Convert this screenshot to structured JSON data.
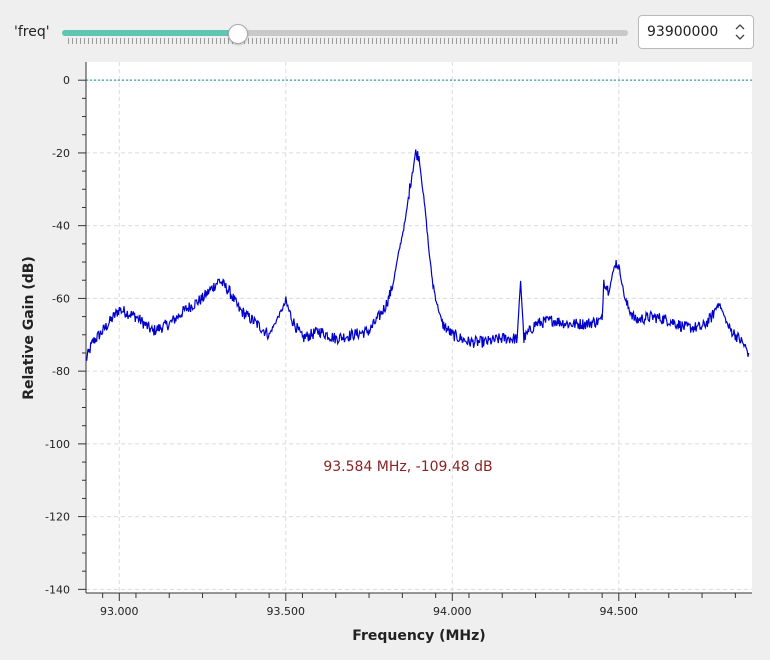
{
  "control": {
    "label": "'freq'",
    "spinbox_value": "93900000",
    "slider_fraction": 0.31
  },
  "plot": {
    "marker_readout": "93.584 MHz, -109.48 dB"
  },
  "colors": {
    "trace": "#0000cc",
    "reference_line": "#0f8a8a",
    "marker_text": "#8b2323",
    "slider_accent": "#5fc7b1"
  },
  "chart_data": {
    "type": "line",
    "xlabel": "Frequency (MHz)",
    "ylabel": "Relative Gain (dB)",
    "xlim": [
      92.9,
      94.9
    ],
    "ylim": [
      -140,
      0
    ],
    "x_ticks": [
      93.0,
      93.5,
      94.0,
      94.5
    ],
    "x_tick_labels": [
      "93.000",
      "93.500",
      "94.000",
      "94.500"
    ],
    "y_ticks": [
      0,
      -20,
      -40,
      -60,
      -80,
      -100,
      -120,
      -140
    ],
    "y_tick_labels": [
      "0",
      "-20",
      "-40",
      "-60",
      "-80",
      "-100",
      "-120",
      "-140"
    ],
    "reference_line_y": 0,
    "grid": true,
    "series": [
      {
        "x": [
          92.9,
          92.92,
          92.95,
          93.0,
          93.05,
          93.1,
          93.15,
          93.2,
          93.25,
          93.28,
          93.3,
          93.33,
          93.36,
          93.4,
          93.45,
          93.5,
          93.52,
          93.55,
          93.6,
          93.65,
          93.7,
          93.75,
          93.78,
          93.8,
          93.82,
          93.84,
          93.86,
          93.87,
          93.88,
          93.89,
          93.9,
          93.91,
          93.92,
          93.93,
          93.94,
          93.95,
          93.97,
          94.0,
          94.05,
          94.1,
          94.15,
          94.195,
          94.205,
          94.215,
          94.25,
          94.3,
          94.35,
          94.4,
          94.45,
          94.455,
          94.47,
          94.49,
          94.5,
          94.52,
          94.55,
          94.6,
          94.65,
          94.7,
          94.75,
          94.78,
          94.8,
          94.83,
          94.87,
          94.89
        ],
        "y": [
          -77,
          -72,
          -69,
          -63,
          -65,
          -69,
          -67,
          -63,
          -60,
          -57,
          -55,
          -58,
          -63,
          -66,
          -70,
          -61,
          -66,
          -71,
          -69,
          -71,
          -70,
          -69,
          -65,
          -62,
          -57,
          -47,
          -38,
          -31,
          -25,
          -20,
          -21,
          -29,
          -37,
          -47,
          -55,
          -60,
          -67,
          -70,
          -72,
          -72,
          -71,
          -71,
          -55,
          -71,
          -67,
          -66,
          -67,
          -67,
          -66,
          -55,
          -58,
          -50,
          -51,
          -61,
          -66,
          -65,
          -66,
          -68,
          -68,
          -65,
          -61,
          -68,
          -72,
          -75
        ]
      }
    ]
  }
}
